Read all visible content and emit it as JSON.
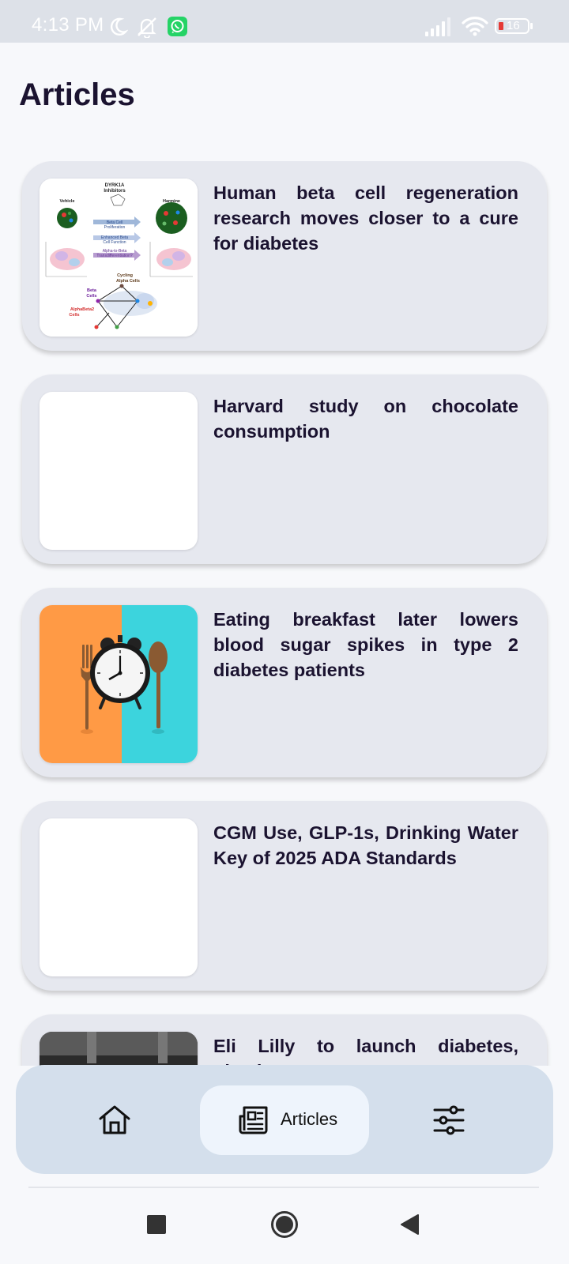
{
  "status_bar": {
    "time": "4:13 PM",
    "battery_level": "16",
    "icons": [
      "moon-icon",
      "bell-off-icon",
      "whatsapp-icon",
      "signal-icon",
      "wifi-icon",
      "battery-icon"
    ]
  },
  "page": {
    "title": "Articles"
  },
  "articles": [
    {
      "title": "Human beta cell regeneration research moves closer to a cure for diabetes",
      "image": "diagram-thumbnail"
    },
    {
      "title": "Harvard study on chocolate consumption",
      "image": "blank"
    },
    {
      "title": "Eating breakfast later lowers blood sugar spikes in type 2 diabetes patients",
      "image": "fork-clock-spoon-photo"
    },
    {
      "title": "CGM Use, GLP-1s, Drinking Water Key of 2025 ADA Standards",
      "image": "blank"
    },
    {
      "title": "Eli Lilly to launch diabetes, obesity",
      "image": "dark-photo"
    }
  ],
  "thumbnail_text": {
    "dyrk": "DYRK1A",
    "inhibitors": "Inhibitors",
    "vehicle": "Vehicle",
    "harmine": "Harmine",
    "prolif1": "Beta Cell",
    "prolif2": "Proliferation",
    "func1": "Enhanced Beta",
    "func2": "Cell Function",
    "trans1": "Alpha-to-Beta",
    "trans2": "Transdifferentiation?",
    "cycling1": "Cycling",
    "cycling2": "Alpha Cells",
    "beta1": "Beta",
    "beta2": "Cells",
    "ab1": "AlphaBeta2",
    "ab2": "Cells"
  },
  "bottom_nav": {
    "items": [
      {
        "name": "home",
        "icon": "home-icon",
        "label": ""
      },
      {
        "name": "articles",
        "icon": "newspaper-icon",
        "label": "Articles",
        "active": true
      },
      {
        "name": "settings",
        "icon": "sliders-icon",
        "label": ""
      }
    ]
  },
  "system_nav": {
    "icons": [
      "recent-apps-square-icon",
      "home-circle-icon",
      "back-triangle-icon"
    ]
  },
  "colors": {
    "card_background": "#e6e8ef",
    "nav_background": "#d4dfec",
    "nav_active": "#eef4fc",
    "title_text": "#1b1330"
  }
}
